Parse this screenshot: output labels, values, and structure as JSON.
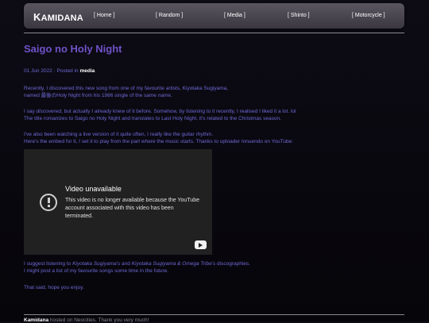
{
  "nav": {
    "logo_first": "K",
    "logo_rest": "AMIDANA",
    "links": [
      "[ Home ]",
      "[ Random ]",
      "[ Media ]",
      "[ Shinto ]",
      "[ Motorcycle ]"
    ]
  },
  "post": {
    "title": "Saigo no Holy Night",
    "date_prefix": "01 Jun 2022 · Posted in ",
    "category": "media",
    "p1_line1": "Recently, I discovered this new song from one of my favourite artists, Kiyotaka Sugiyama,",
    "p1_line2": "named 最後のHoly Night from his 1986 single of the same name.",
    "p2_a": "I say ",
    "p2_em": "discovered",
    "p2_b": ", but actually I already knew of it before. Somehow, by listening to it recently, I realised I liked it a lot. lol",
    "p2_line2": "The title romanizes to Saigo no Holy Night and translates to Last Holy Night, it's related to the Christmas season.",
    "p3_line1": "I've also been watching a live version of it quite often, I really like the guitar rhythm.",
    "p3_line2": "Here's the embed for it, I set it to play from the part where the music starts. Thanks to uploader Innuendo on YouTube:",
    "video": {
      "title": "Video unavailable",
      "message": "This video is no longer available because the YouTube account associated with this video has been terminated.",
      "icon": "alert-circle-icon"
    },
    "p4_a": "I suggest listening to ",
    "p4_em1": "Kiyotaka Sugiyama's",
    "p4_b": " and ",
    "p4_em2": "Kiyotaka Sugiyama & Omega Tribe's",
    "p4_c": " discographies.",
    "p4_line2": "I might post a list of my favourite songs some time in the future.",
    "p5": "That said, hope you enjoy."
  },
  "footer": {
    "site": "Kamidana",
    "text": " hosted on Neocities. Thank you very much!"
  }
}
